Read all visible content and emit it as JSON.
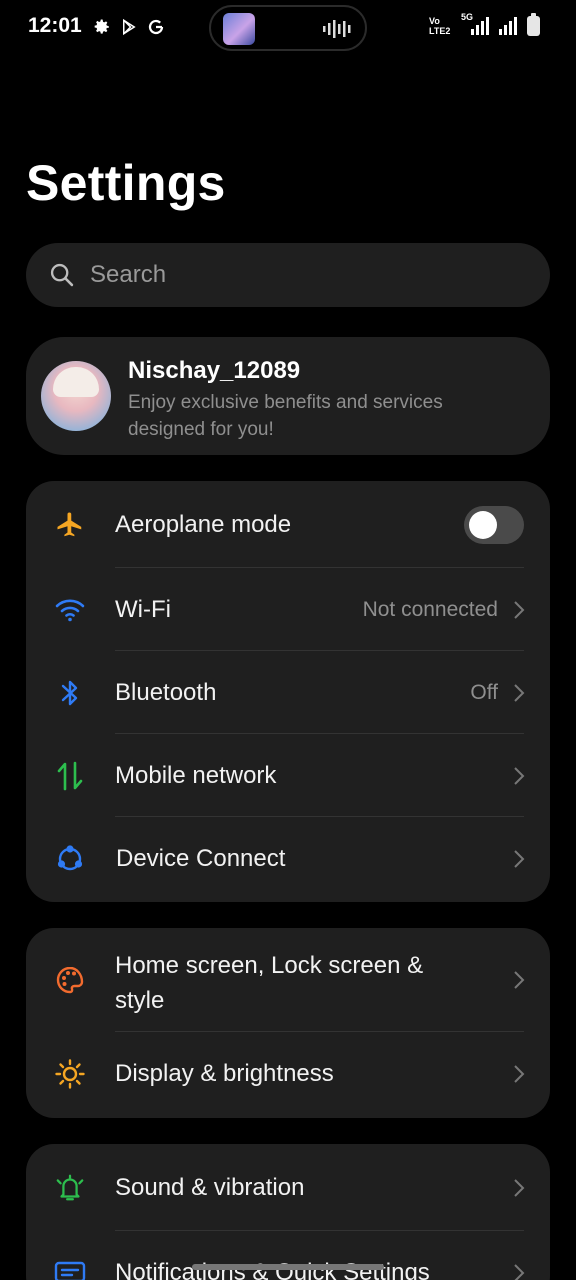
{
  "status_bar": {
    "time": "12:01",
    "volte_line1": "Vo",
    "volte_line2": "LTE2",
    "network_type": "5G"
  },
  "page": {
    "title": "Settings"
  },
  "search": {
    "placeholder": "Search"
  },
  "profile": {
    "name": "Nischay_12089",
    "subtitle": "Enjoy exclusive benefits and services designed for you!"
  },
  "group1": {
    "aeroplane": {
      "label": "Aeroplane mode",
      "enabled": false,
      "icon": "airplane-icon",
      "color": "#F5A623"
    },
    "wifi": {
      "label": "Wi-Fi",
      "value": "Not connected",
      "icon": "wifi-icon",
      "color": "#2F7BF5"
    },
    "bluetooth": {
      "label": "Bluetooth",
      "value": "Off",
      "icon": "bluetooth-icon",
      "color": "#2F7BF5"
    },
    "mobile": {
      "label": "Mobile network",
      "icon": "mobile-data-icon",
      "color": "#2DBE4E"
    },
    "device_connect": {
      "label": "Device Connect",
      "icon": "device-connect-icon",
      "color": "#2F7BF5"
    }
  },
  "group2": {
    "home_screen": {
      "label": "Home screen, Lock screen & style",
      "icon": "palette-icon",
      "color": "#F26B2E"
    },
    "display": {
      "label": "Display & brightness",
      "icon": "sun-icon",
      "color": "#F5A623"
    }
  },
  "group3": {
    "sound": {
      "label": "Sound & vibration",
      "icon": "bell-icon",
      "color": "#2DBE4E"
    },
    "notifications": {
      "label": "Notifications & Quick Settings",
      "icon": "notification-icon",
      "color": "#2F7BF5"
    }
  }
}
